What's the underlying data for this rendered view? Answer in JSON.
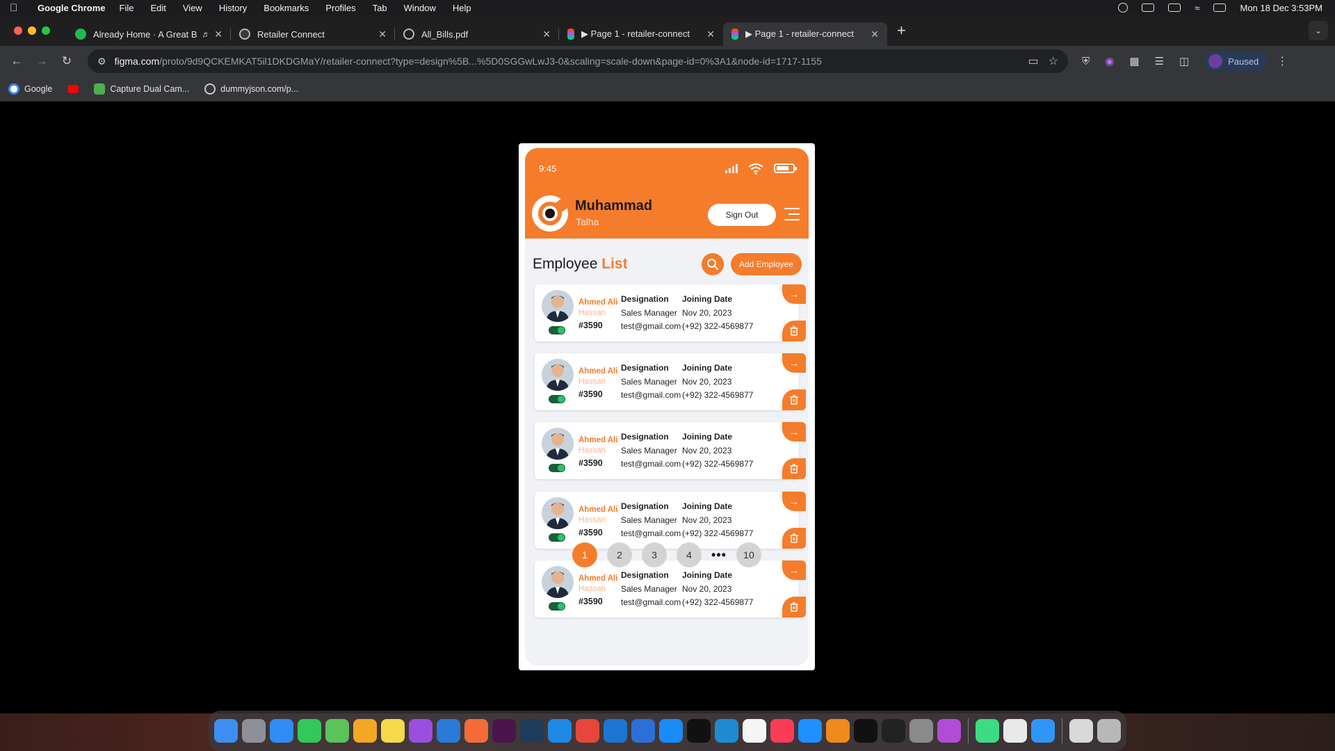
{
  "menubar": {
    "app_name": "Google Chrome",
    "items": [
      "File",
      "Edit",
      "View",
      "History",
      "Bookmarks",
      "Profiles",
      "Tab",
      "Window",
      "Help"
    ],
    "clock": "Mon 18 Dec  3:53PM"
  },
  "tabs": [
    {
      "title": "Already Home · A Great B",
      "favicon": "spotify-icon",
      "color": "#1db954",
      "audio": true
    },
    {
      "title": "Retailer Connect",
      "favicon": "retailer-connect-icon",
      "color": "#3a3a3a"
    },
    {
      "title": "All_Bills.pdf",
      "favicon": "globe-icon",
      "color": "#555555"
    },
    {
      "title": "▶ Page 1 - retailer-connect",
      "favicon": "figma-icon",
      "color": "#a259ff"
    },
    {
      "title": "▶ Page 1 - retailer-connect",
      "favicon": "figma-icon",
      "color": "#a259ff",
      "active": true
    }
  ],
  "toolbar": {
    "url_host": "figma.com",
    "url_path": "/proto/9d9QCKEMKAT5il1DKDGMaY/retailer-connect?type=design%5B...%5D0SGGwLwJ3-0&scaling=scale-down&page-id=0%3A1&node-id=1717-1155",
    "profile_label": "Paused"
  },
  "bookmarks": [
    {
      "label": "Google",
      "icon": "google-icon",
      "color": "#4285f4"
    },
    {
      "label": "",
      "icon": "youtube-icon",
      "color": "#ff0000"
    },
    {
      "label": "Capture Dual Cam...",
      "icon": "camera-app-icon",
      "color": "#4caf50"
    },
    {
      "label": "dummyjson.com/p...",
      "icon": "globe-icon",
      "color": "#888888"
    }
  ],
  "app": {
    "status_time": "9:45",
    "user_first": "Muhammad",
    "user_last": "Talha",
    "sign_out": "Sign Out",
    "list_title_a": "Employee",
    "list_title_b": "List",
    "add_employee": "Add Employee",
    "accent_color": "#f57c2b",
    "employees": [
      {
        "first": "Ahmed Ali",
        "last": "Hassan",
        "id": "#3590",
        "designation_label": "Designation",
        "designation": "Sales Manager",
        "email": "test@gmail.com",
        "joining_label": "Joining Date",
        "joining_date": "Nov 20, 2023",
        "phone": "(+92) 322-4569877",
        "active": true
      },
      {
        "first": "Ahmed Ali",
        "last": "Hassan",
        "id": "#3590",
        "designation_label": "Designation",
        "designation": "Sales Manager",
        "email": "test@gmail.com",
        "joining_label": "Joining Date",
        "joining_date": "Nov 20, 2023",
        "phone": "(+92) 322-4569877",
        "active": true
      },
      {
        "first": "Ahmed Ali",
        "last": "Hassan",
        "id": "#3590",
        "designation_label": "Designation",
        "designation": "Sales Manager",
        "email": "test@gmail.com",
        "joining_label": "Joining Date",
        "joining_date": "Nov 20, 2023",
        "phone": "(+92) 322-4569877",
        "active": true
      },
      {
        "first": "Ahmed Ali",
        "last": "Hassan",
        "id": "#3590",
        "designation_label": "Designation",
        "designation": "Sales Manager",
        "email": "test@gmail.com",
        "joining_label": "Joining Date",
        "joining_date": "Nov 20, 2023",
        "phone": "(+92) 322-4569877",
        "active": true
      },
      {
        "first": "Ahmed Ali",
        "last": "Hassan",
        "id": "#3590",
        "designation_label": "Designation",
        "designation": "Sales Manager",
        "email": "test@gmail.com",
        "joining_label": "Joining Date",
        "joining_date": "Nov 20, 2023",
        "phone": "(+92) 322-4569877",
        "active": true
      }
    ],
    "pagination": {
      "pages": [
        "1",
        "2",
        "3",
        "4"
      ],
      "ellipsis": "•••",
      "last": "10",
      "current": "1"
    }
  },
  "dock": {
    "apps": [
      {
        "name": "finder-icon",
        "color": "#3d8ef0"
      },
      {
        "name": "launchpad-icon",
        "color": "#8f8f9a"
      },
      {
        "name": "mail-icon",
        "color": "#2f8cf4"
      },
      {
        "name": "facetime-icon",
        "color": "#34c759"
      },
      {
        "name": "maps-icon",
        "color": "#5ac35a"
      },
      {
        "name": "photos-icon",
        "color": "#f5a623"
      },
      {
        "name": "notes-icon",
        "color": "#f7d94c"
      },
      {
        "name": "podcasts-icon",
        "color": "#9b4de0"
      },
      {
        "name": "freeform-icon",
        "color": "#2a7ad8"
      },
      {
        "name": "swift-playgrounds-icon",
        "color": "#f26b38"
      },
      {
        "name": "slack-icon",
        "color": "#4a154b"
      },
      {
        "name": "quicktime-icon",
        "color": "#1f3b5c"
      },
      {
        "name": "safari-icon",
        "color": "#1e88e5"
      },
      {
        "name": "chrome-icon",
        "color": "#e8453c"
      },
      {
        "name": "xcode-icon",
        "color": "#1b76d1"
      },
      {
        "name": "simulator-icon",
        "color": "#2d6fd9"
      },
      {
        "name": "app-store-icon",
        "color": "#1a8cf8"
      },
      {
        "name": "terminal-icon",
        "color": "#111111"
      },
      {
        "name": "vscode-icon",
        "color": "#1f8ad2"
      },
      {
        "name": "calendar-icon",
        "color": "#f5f5f5"
      },
      {
        "name": "music-icon",
        "color": "#fa3c57"
      },
      {
        "name": "testflight-icon",
        "color": "#1e90ff"
      },
      {
        "name": "vlc-icon",
        "color": "#f08a1c"
      },
      {
        "name": "apple-tv-icon",
        "color": "#111111"
      },
      {
        "name": "iterm-icon",
        "color": "#222222"
      },
      {
        "name": "system-settings-icon",
        "color": "#8a8a8a"
      },
      {
        "name": "feedback-icon",
        "color": "#b24cd6"
      },
      {
        "name": "android-studio-icon",
        "color": "#3ddc84"
      },
      {
        "name": "textedit-icon",
        "color": "#e9e9e9"
      },
      {
        "name": "app-store-alt-icon",
        "color": "#2f95f7"
      },
      {
        "name": "documents-folder-icon",
        "color": "#d9d9d9"
      },
      {
        "name": "trash-icon",
        "color": "#b8b8b8"
      }
    ]
  }
}
